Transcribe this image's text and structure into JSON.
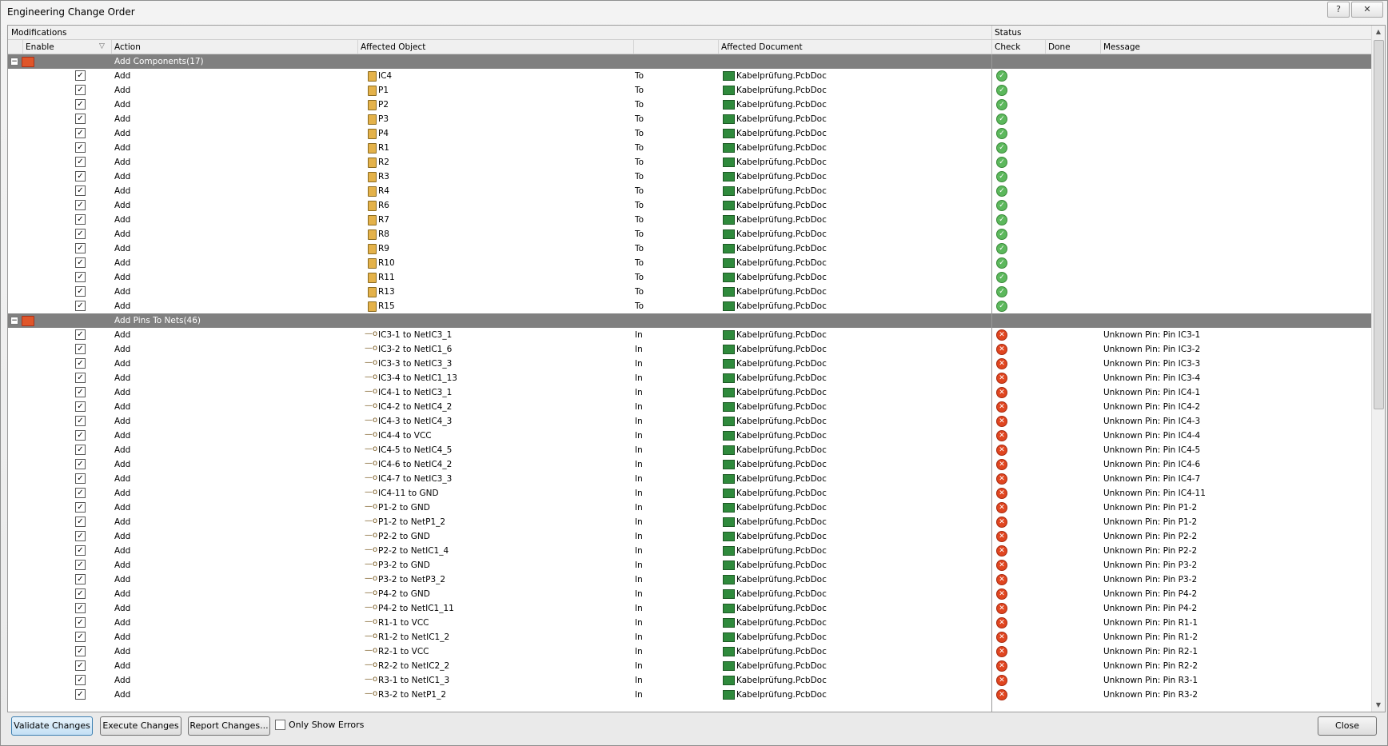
{
  "window": {
    "title": "Engineering Change Order",
    "help_icon": "?",
    "close_icon": "✕"
  },
  "headers": {
    "modifications": "Modifications",
    "status": "Status",
    "enable": "Enable",
    "action": "Action",
    "affected_object": "Affected Object",
    "affected_document": "Affected Document",
    "check": "Check",
    "done": "Done",
    "message": "Message"
  },
  "groups": [
    {
      "label": "Add Components(17)",
      "expander": "−",
      "rows": [
        {
          "action": "Add",
          "object": "IC4",
          "dir": "To",
          "doc": "Kabelprüfung.PcbDoc",
          "check": "ok",
          "message": ""
        },
        {
          "action": "Add",
          "object": "P1",
          "dir": "To",
          "doc": "Kabelprüfung.PcbDoc",
          "check": "ok",
          "message": ""
        },
        {
          "action": "Add",
          "object": "P2",
          "dir": "To",
          "doc": "Kabelprüfung.PcbDoc",
          "check": "ok",
          "message": ""
        },
        {
          "action": "Add",
          "object": "P3",
          "dir": "To",
          "doc": "Kabelprüfung.PcbDoc",
          "check": "ok",
          "message": ""
        },
        {
          "action": "Add",
          "object": "P4",
          "dir": "To",
          "doc": "Kabelprüfung.PcbDoc",
          "check": "ok",
          "message": ""
        },
        {
          "action": "Add",
          "object": "R1",
          "dir": "To",
          "doc": "Kabelprüfung.PcbDoc",
          "check": "ok",
          "message": ""
        },
        {
          "action": "Add",
          "object": "R2",
          "dir": "To",
          "doc": "Kabelprüfung.PcbDoc",
          "check": "ok",
          "message": ""
        },
        {
          "action": "Add",
          "object": "R3",
          "dir": "To",
          "doc": "Kabelprüfung.PcbDoc",
          "check": "ok",
          "message": ""
        },
        {
          "action": "Add",
          "object": "R4",
          "dir": "To",
          "doc": "Kabelprüfung.PcbDoc",
          "check": "ok",
          "message": ""
        },
        {
          "action": "Add",
          "object": "R6",
          "dir": "To",
          "doc": "Kabelprüfung.PcbDoc",
          "check": "ok",
          "message": ""
        },
        {
          "action": "Add",
          "object": "R7",
          "dir": "To",
          "doc": "Kabelprüfung.PcbDoc",
          "check": "ok",
          "message": ""
        },
        {
          "action": "Add",
          "object": "R8",
          "dir": "To",
          "doc": "Kabelprüfung.PcbDoc",
          "check": "ok",
          "message": ""
        },
        {
          "action": "Add",
          "object": "R9",
          "dir": "To",
          "doc": "Kabelprüfung.PcbDoc",
          "check": "ok",
          "message": ""
        },
        {
          "action": "Add",
          "object": "R10",
          "dir": "To",
          "doc": "Kabelprüfung.PcbDoc",
          "check": "ok",
          "message": ""
        },
        {
          "action": "Add",
          "object": "R11",
          "dir": "To",
          "doc": "Kabelprüfung.PcbDoc",
          "check": "ok",
          "message": ""
        },
        {
          "action": "Add",
          "object": "R13",
          "dir": "To",
          "doc": "Kabelprüfung.PcbDoc",
          "check": "ok",
          "message": ""
        },
        {
          "action": "Add",
          "object": "R15",
          "dir": "To",
          "doc": "Kabelprüfung.PcbDoc",
          "check": "ok",
          "message": ""
        }
      ]
    },
    {
      "label": "Add Pins To Nets(46)",
      "expander": "−",
      "rows": [
        {
          "action": "Add",
          "object": "IC3-1 to NetIC3_1",
          "dir": "In",
          "doc": "Kabelprüfung.PcbDoc",
          "check": "err",
          "message": "Unknown Pin: Pin IC3-1"
        },
        {
          "action": "Add",
          "object": "IC3-2 to NetIC1_6",
          "dir": "In",
          "doc": "Kabelprüfung.PcbDoc",
          "check": "err",
          "message": "Unknown Pin: Pin IC3-2"
        },
        {
          "action": "Add",
          "object": "IC3-3 to NetIC3_3",
          "dir": "In",
          "doc": "Kabelprüfung.PcbDoc",
          "check": "err",
          "message": "Unknown Pin: Pin IC3-3"
        },
        {
          "action": "Add",
          "object": "IC3-4 to NetIC1_13",
          "dir": "In",
          "doc": "Kabelprüfung.PcbDoc",
          "check": "err",
          "message": "Unknown Pin: Pin IC3-4"
        },
        {
          "action": "Add",
          "object": "IC4-1 to NetIC3_1",
          "dir": "In",
          "doc": "Kabelprüfung.PcbDoc",
          "check": "err",
          "message": "Unknown Pin: Pin IC4-1"
        },
        {
          "action": "Add",
          "object": "IC4-2 to NetIC4_2",
          "dir": "In",
          "doc": "Kabelprüfung.PcbDoc",
          "check": "err",
          "message": "Unknown Pin: Pin IC4-2"
        },
        {
          "action": "Add",
          "object": "IC4-3 to NetIC4_3",
          "dir": "In",
          "doc": "Kabelprüfung.PcbDoc",
          "check": "err",
          "message": "Unknown Pin: Pin IC4-3"
        },
        {
          "action": "Add",
          "object": "IC4-4 to VCC",
          "dir": "In",
          "doc": "Kabelprüfung.PcbDoc",
          "check": "err",
          "message": "Unknown Pin: Pin IC4-4"
        },
        {
          "action": "Add",
          "object": "IC4-5 to NetIC4_5",
          "dir": "In",
          "doc": "Kabelprüfung.PcbDoc",
          "check": "err",
          "message": "Unknown Pin: Pin IC4-5"
        },
        {
          "action": "Add",
          "object": "IC4-6 to NetIC4_2",
          "dir": "In",
          "doc": "Kabelprüfung.PcbDoc",
          "check": "err",
          "message": "Unknown Pin: Pin IC4-6"
        },
        {
          "action": "Add",
          "object": "IC4-7 to NetIC3_3",
          "dir": "In",
          "doc": "Kabelprüfung.PcbDoc",
          "check": "err",
          "message": "Unknown Pin: Pin IC4-7"
        },
        {
          "action": "Add",
          "object": "IC4-11 to GND",
          "dir": "In",
          "doc": "Kabelprüfung.PcbDoc",
          "check": "err",
          "message": "Unknown Pin: Pin IC4-11"
        },
        {
          "action": "Add",
          "object": "P1-2 to GND",
          "dir": "In",
          "doc": "Kabelprüfung.PcbDoc",
          "check": "err",
          "message": "Unknown Pin: Pin P1-2"
        },
        {
          "action": "Add",
          "object": "P1-2 to NetP1_2",
          "dir": "In",
          "doc": "Kabelprüfung.PcbDoc",
          "check": "err",
          "message": "Unknown Pin: Pin P1-2"
        },
        {
          "action": "Add",
          "object": "P2-2 to GND",
          "dir": "In",
          "doc": "Kabelprüfung.PcbDoc",
          "check": "err",
          "message": "Unknown Pin: Pin P2-2"
        },
        {
          "action": "Add",
          "object": "P2-2 to NetIC1_4",
          "dir": "In",
          "doc": "Kabelprüfung.PcbDoc",
          "check": "err",
          "message": "Unknown Pin: Pin P2-2"
        },
        {
          "action": "Add",
          "object": "P3-2 to GND",
          "dir": "In",
          "doc": "Kabelprüfung.PcbDoc",
          "check": "err",
          "message": "Unknown Pin: Pin P3-2"
        },
        {
          "action": "Add",
          "object": "P3-2 to NetP3_2",
          "dir": "In",
          "doc": "Kabelprüfung.PcbDoc",
          "check": "err",
          "message": "Unknown Pin: Pin P3-2"
        },
        {
          "action": "Add",
          "object": "P4-2 to GND",
          "dir": "In",
          "doc": "Kabelprüfung.PcbDoc",
          "check": "err",
          "message": "Unknown Pin: Pin P4-2"
        },
        {
          "action": "Add",
          "object": "P4-2 to NetIC1_11",
          "dir": "In",
          "doc": "Kabelprüfung.PcbDoc",
          "check": "err",
          "message": "Unknown Pin: Pin P4-2"
        },
        {
          "action": "Add",
          "object": "R1-1 to VCC",
          "dir": "In",
          "doc": "Kabelprüfung.PcbDoc",
          "check": "err",
          "message": "Unknown Pin: Pin R1-1"
        },
        {
          "action": "Add",
          "object": "R1-2 to NetIC1_2",
          "dir": "In",
          "doc": "Kabelprüfung.PcbDoc",
          "check": "err",
          "message": "Unknown Pin: Pin R1-2"
        },
        {
          "action": "Add",
          "object": "R2-1 to VCC",
          "dir": "In",
          "doc": "Kabelprüfung.PcbDoc",
          "check": "err",
          "message": "Unknown Pin: Pin R2-1"
        },
        {
          "action": "Add",
          "object": "R2-2 to NetIC2_2",
          "dir": "In",
          "doc": "Kabelprüfung.PcbDoc",
          "check": "err",
          "message": "Unknown Pin: Pin R2-2"
        },
        {
          "action": "Add",
          "object": "R3-1 to NetIC1_3",
          "dir": "In",
          "doc": "Kabelprüfung.PcbDoc",
          "check": "err",
          "message": "Unknown Pin: Pin R3-1"
        },
        {
          "action": "Add",
          "object": "R3-2 to NetP1_2",
          "dir": "In",
          "doc": "Kabelprüfung.PcbDoc",
          "check": "err",
          "message": "Unknown Pin: Pin R3-2"
        }
      ]
    }
  ],
  "check_glyphs": {
    "ok": "✓",
    "err": "✕",
    "checkbox": "✓"
  },
  "buttons": {
    "validate": "Validate Changes",
    "execute": "Execute Changes",
    "report": "Report Changes...",
    "only_errors": "Only Show Errors",
    "close": "Close"
  }
}
